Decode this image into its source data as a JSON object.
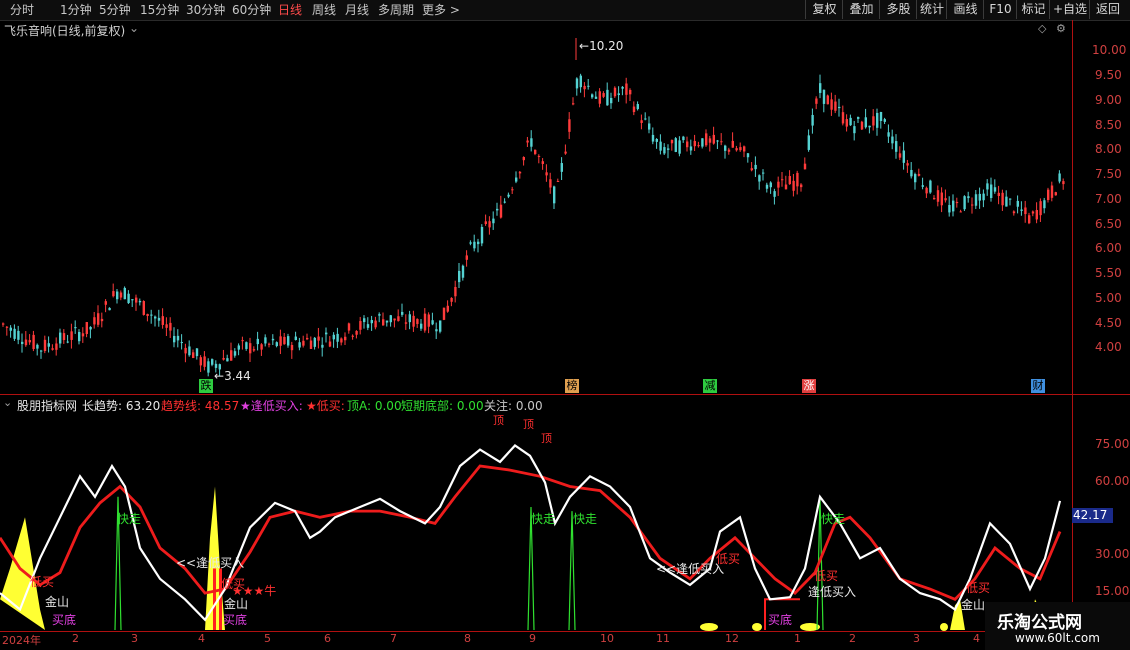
{
  "toolbar": {
    "periods": [
      "分时",
      "1分钟",
      "5分钟",
      "15分钟",
      "30分钟",
      "60分钟",
      "日线",
      "周线",
      "月线",
      "多周期",
      "更多 >"
    ],
    "active_period": "日线",
    "right_buttons": [
      "复权",
      "叠加",
      "多股",
      "统计",
      "画线",
      "F10",
      "标记",
      "+自选",
      "返回"
    ]
  },
  "main_panel": {
    "title": "飞乐音响(日线,前复权)",
    "high_label": "10.20",
    "low_label": "3.44",
    "y_ticks": [
      "10.00",
      "9.50",
      "9.00",
      "8.50",
      "8.00",
      "7.50",
      "7.00",
      "6.50",
      "6.00",
      "5.50",
      "5.00",
      "4.50",
      "4.00"
    ],
    "event_markers": [
      {
        "text": "跌",
        "color": "#2ecc40"
      },
      {
        "text": "榜",
        "color": "#e0a050"
      },
      {
        "text": "减",
        "color": "#2ecc40"
      },
      {
        "text": "涨",
        "color": "#e04040"
      },
      {
        "text": "财",
        "color": "#4090e0"
      }
    ]
  },
  "indicator_panel": {
    "name": "股朋指标网",
    "items": [
      {
        "label": "长趋势: 63.20",
        "color": "#e8e8e8"
      },
      {
        "label": "趋势线: 48.57",
        "color": "#ff3030"
      },
      {
        "label": "★逢低买入: ",
        "color": "#e040e0"
      },
      {
        "label": "★低买: ",
        "color": "#ff3030"
      },
      {
        "label": "顶A: 0.00",
        "color": "#30e030"
      },
      {
        "label": "短期底部: 0.00",
        "color": "#30e030"
      },
      {
        "label": "关注: 0.00",
        "color": "#c8c8c8"
      }
    ],
    "y_ticks": [
      "75.00",
      "60.00",
      "45.00",
      "30.00",
      "15.00"
    ],
    "current_value": "42.17",
    "annotations": [
      {
        "text": "顶",
        "color": "#ff3030"
      },
      {
        "text": "顶",
        "color": "#ff3030"
      },
      {
        "text": "顶",
        "color": "#ff3030"
      },
      {
        "text": "快走",
        "color": "#30e030"
      },
      {
        "text": "快走",
        "color": "#30e030"
      },
      {
        "text": "快走",
        "color": "#30e030"
      },
      {
        "text": "快走",
        "color": "#30e030"
      },
      {
        "text": "<<逢低买入",
        "color": "#e8e8e8"
      },
      {
        "text": "<<逢低买入",
        "color": "#e8e8e8"
      },
      {
        "text": "逢低买入",
        "color": "#e8e8e8"
      },
      {
        "text": "低买",
        "color": "#ff3030"
      },
      {
        "text": "低买",
        "color": "#ff3030"
      },
      {
        "text": "低买",
        "color": "#ff3030"
      },
      {
        "text": "低买",
        "color": "#ff3030"
      },
      {
        "text": "低买",
        "color": "#ff3030"
      },
      {
        "text": "★★★牛",
        "color": "#ff3030"
      },
      {
        "text": "金山",
        "color": "#e8e8e8"
      },
      {
        "text": "金山",
        "color": "#e8e8e8"
      },
      {
        "text": "金山",
        "color": "#e8e8e8"
      },
      {
        "text": "买底",
        "color": "#e040e0"
      },
      {
        "text": "买底",
        "color": "#e040e0"
      },
      {
        "text": "买底",
        "color": "#e040e0"
      }
    ]
  },
  "time_axis": [
    "2024年",
    "2",
    "3",
    "4",
    "5",
    "6",
    "7",
    "8",
    "9",
    "10",
    "11",
    "12",
    "1",
    "2",
    "3",
    "4"
  ],
  "watermark": {
    "title": "乐淘公式网",
    "url": "www.60lt.com"
  }
}
